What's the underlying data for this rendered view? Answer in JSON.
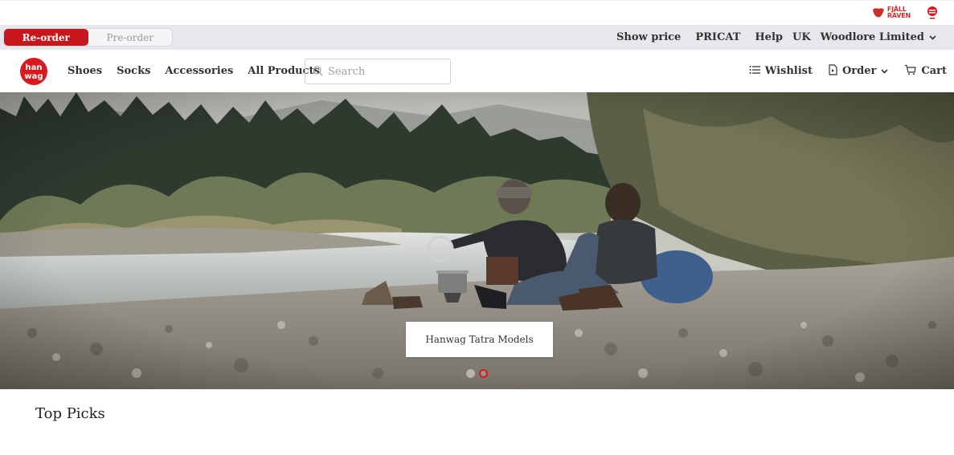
{
  "brands": {
    "secondary_name": "FJÄLL RÄVEN"
  },
  "mode_toggle": {
    "options": [
      "Re-order",
      "Pre-order"
    ],
    "selected": "Re-order"
  },
  "topbar": {
    "show_price": "Show price",
    "pricat": "PRICAT",
    "help": "Help",
    "region": "UK",
    "account": "Woodlore Limited"
  },
  "nav": {
    "links": [
      "Shoes",
      "Socks",
      "Accessories",
      "All Products"
    ],
    "search_placeholder": "Search",
    "wishlist": "Wishlist",
    "order": "Order",
    "cart": "Cart"
  },
  "hero": {
    "caption": "Hanwag Tatra Models",
    "slide_count": 2,
    "active_slide": 2
  },
  "sections": {
    "top_picks": "Top Picks"
  },
  "colors": {
    "brand_red": "#c8161d",
    "bar_grey": "#e6e8ec"
  }
}
